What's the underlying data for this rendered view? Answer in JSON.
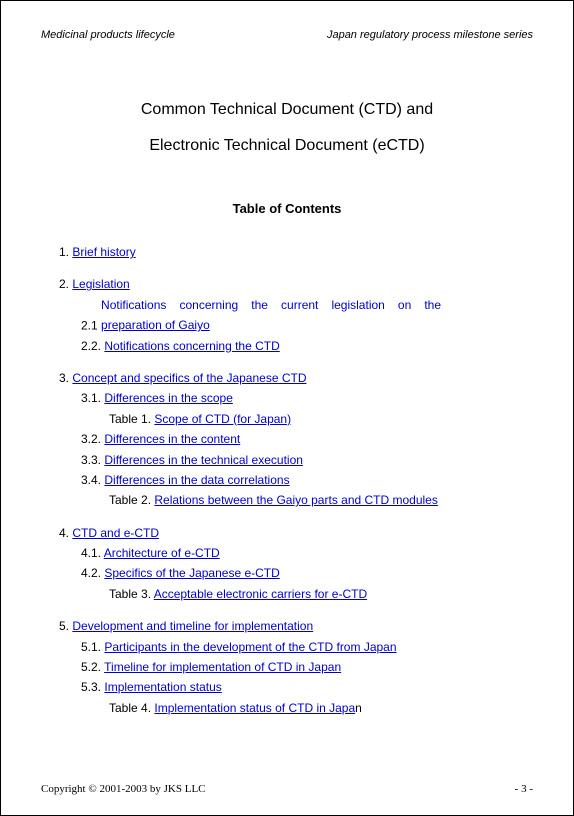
{
  "header": {
    "left": "Medicinal products lifecycle",
    "right": "Japan regulatory process milestone series"
  },
  "title": {
    "line1": "Common Technical Document (CTD) and",
    "line2": "Electronic Technical Document (eCTD)"
  },
  "toc_heading": "Table of Contents",
  "toc": {
    "s1": {
      "num": "1.",
      "label": "Brief history"
    },
    "s2": {
      "num": "2.",
      "label": "Legislation",
      "s2_1": {
        "num": "2.1",
        "label_l1": "Notifications concerning the current legislation on the",
        "label_l2": "preparation of Gaiyo"
      },
      "s2_2": {
        "num": "2.2.",
        "label": "Notifications concerning the CTD"
      }
    },
    "s3": {
      "num": "3.",
      "label": "Concept and specifics of the Japanese CTD",
      "s3_1": {
        "num": "3.1.",
        "label": "Differences in the scope"
      },
      "t1": {
        "prefix": "Table 1.",
        "label": "Scope of CTD (for Japan)"
      },
      "s3_2": {
        "num": "3.2.",
        "label": "Differences in the content"
      },
      "s3_3": {
        "num": "3.3.",
        "label": "Differences in the technical execution"
      },
      "s3_4": {
        "num": "3.4.",
        "label": "Differences in the data correlations"
      },
      "t2": {
        "prefix": "Table 2.",
        "label": "Relations between the Gaiyo parts and CTD modules"
      }
    },
    "s4": {
      "num": "4.",
      "label": "CTD and e-CTD",
      "s4_1": {
        "num": "4.1.",
        "label": "Architecture of e-CTD"
      },
      "s4_2": {
        "num": "4.2.",
        "label": "Specifics of the Japanese e-CTD"
      },
      "t3": {
        "prefix": "Table 3.",
        "label": "Acceptable electronic carriers for e-CTD"
      }
    },
    "s5": {
      "num": "5.",
      "label": "Development and timeline for implementation",
      "s5_1": {
        "num": "5.1.",
        "label": "Participants in the development of the CTD from Japan"
      },
      "s5_2": {
        "num": "5.2.",
        "label": "Timeline for implementation of CTD in Japan"
      },
      "s5_3": {
        "num": "5.3.",
        "label": "Implementation status"
      },
      "t4": {
        "prefix": "Table 4.",
        "label": "Implementation status of CTD in Japa",
        "tail": "n"
      }
    }
  },
  "footer": {
    "copyright": "Copyright © 2001-2003 by JKS LLC",
    "page": "- 3 -"
  }
}
